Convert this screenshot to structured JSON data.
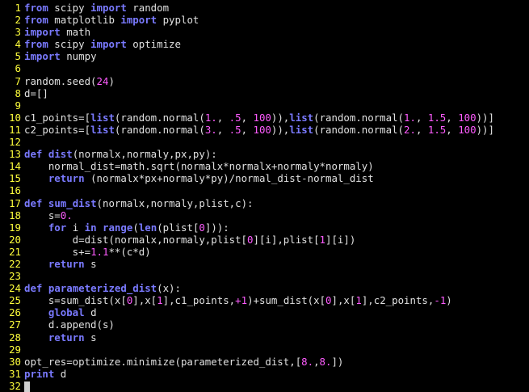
{
  "editor": {
    "colors": {
      "background": "#000000",
      "line_number": "#ffff3c",
      "text": "#e0e0e0",
      "keyword": "#7a7aff",
      "number": "#ff5cff",
      "builtin": "#3fe0ff"
    },
    "lines": [
      {
        "n": "1",
        "tokens": [
          {
            "t": "from",
            "c": "kw"
          },
          {
            "t": " scipy "
          },
          {
            "t": "import",
            "c": "kw"
          },
          {
            "t": " random"
          }
        ]
      },
      {
        "n": "2",
        "tokens": [
          {
            "t": "from",
            "c": "kw"
          },
          {
            "t": " matplotlib "
          },
          {
            "t": "import",
            "c": "kw"
          },
          {
            "t": " pyplot"
          }
        ]
      },
      {
        "n": "3",
        "tokens": [
          {
            "t": "import",
            "c": "kw"
          },
          {
            "t": " math"
          }
        ]
      },
      {
        "n": "4",
        "tokens": [
          {
            "t": "from",
            "c": "kw"
          },
          {
            "t": " scipy "
          },
          {
            "t": "import",
            "c": "kw"
          },
          {
            "t": " optimize"
          }
        ]
      },
      {
        "n": "5",
        "tokens": [
          {
            "t": "import",
            "c": "kw"
          },
          {
            "t": " numpy"
          }
        ]
      },
      {
        "n": "6",
        "tokens": []
      },
      {
        "n": "7",
        "tokens": [
          {
            "t": "random.seed("
          },
          {
            "t": "24",
            "c": "num"
          },
          {
            "t": ")"
          }
        ]
      },
      {
        "n": "8",
        "tokens": [
          {
            "t": "d=[]"
          }
        ]
      },
      {
        "n": "9",
        "tokens": []
      },
      {
        "n": "10",
        "tokens": [
          {
            "t": "c1_points=["
          },
          {
            "t": "list",
            "c": "kw"
          },
          {
            "t": "(random.normal("
          },
          {
            "t": "1.",
            "c": "num"
          },
          {
            "t": ", "
          },
          {
            "t": ".5",
            "c": "num"
          },
          {
            "t": ", "
          },
          {
            "t": "100",
            "c": "num"
          },
          {
            "t": ")),"
          },
          {
            "t": "list",
            "c": "kw"
          },
          {
            "t": "(random.normal("
          },
          {
            "t": "1.",
            "c": "num"
          },
          {
            "t": ", "
          },
          {
            "t": "1.5",
            "c": "num"
          },
          {
            "t": ", "
          },
          {
            "t": "100",
            "c": "num"
          },
          {
            "t": "))]"
          }
        ]
      },
      {
        "n": "11",
        "tokens": [
          {
            "t": "c2_points=["
          },
          {
            "t": "list",
            "c": "kw"
          },
          {
            "t": "(random.normal("
          },
          {
            "t": "3.",
            "c": "num"
          },
          {
            "t": ", "
          },
          {
            "t": ".5",
            "c": "num"
          },
          {
            "t": ", "
          },
          {
            "t": "100",
            "c": "num"
          },
          {
            "t": ")),"
          },
          {
            "t": "list",
            "c": "kw"
          },
          {
            "t": "(random.normal("
          },
          {
            "t": "2.",
            "c": "num"
          },
          {
            "t": ", "
          },
          {
            "t": "1.5",
            "c": "num"
          },
          {
            "t": ", "
          },
          {
            "t": "100",
            "c": "num"
          },
          {
            "t": "))]"
          }
        ]
      },
      {
        "n": "12",
        "tokens": []
      },
      {
        "n": "13",
        "tokens": [
          {
            "t": "def",
            "c": "kw"
          },
          {
            "t": " "
          },
          {
            "t": "dist",
            "c": "kw"
          },
          {
            "t": "(normalx,normaly,px,py):"
          }
        ]
      },
      {
        "n": "14",
        "tokens": [
          {
            "t": "    normal_dist=math.sqrt(normalx*normalx+normaly*normaly)"
          }
        ]
      },
      {
        "n": "15",
        "tokens": [
          {
            "t": "    "
          },
          {
            "t": "return",
            "c": "kw"
          },
          {
            "t": " (normalx*px+normaly*py)/normal_dist-normal_dist"
          }
        ]
      },
      {
        "n": "16",
        "tokens": []
      },
      {
        "n": "17",
        "tokens": [
          {
            "t": "def",
            "c": "kw"
          },
          {
            "t": " "
          },
          {
            "t": "sum_dist",
            "c": "kw"
          },
          {
            "t": "(normalx,normaly,plist,c):"
          }
        ]
      },
      {
        "n": "18",
        "tokens": [
          {
            "t": "    s="
          },
          {
            "t": "0.",
            "c": "num"
          }
        ]
      },
      {
        "n": "19",
        "tokens": [
          {
            "t": "    "
          },
          {
            "t": "for",
            "c": "kw"
          },
          {
            "t": " i "
          },
          {
            "t": "in",
            "c": "kw"
          },
          {
            "t": " "
          },
          {
            "t": "range",
            "c": "kw"
          },
          {
            "t": "("
          },
          {
            "t": "len",
            "c": "kw"
          },
          {
            "t": "(plist["
          },
          {
            "t": "0",
            "c": "num"
          },
          {
            "t": "])):"
          }
        ]
      },
      {
        "n": "20",
        "tokens": [
          {
            "t": "        d=dist(normalx,normaly,plist["
          },
          {
            "t": "0",
            "c": "num"
          },
          {
            "t": "][i],plist["
          },
          {
            "t": "1",
            "c": "num"
          },
          {
            "t": "][i])"
          }
        ]
      },
      {
        "n": "21",
        "tokens": [
          {
            "t": "        s+="
          },
          {
            "t": "1.1",
            "c": "num"
          },
          {
            "t": "**(c*d)"
          }
        ]
      },
      {
        "n": "22",
        "tokens": [
          {
            "t": "    "
          },
          {
            "t": "return",
            "c": "kw"
          },
          {
            "t": " s"
          }
        ]
      },
      {
        "n": "23",
        "tokens": []
      },
      {
        "n": "24",
        "tokens": [
          {
            "t": "def",
            "c": "kw"
          },
          {
            "t": " "
          },
          {
            "t": "parameterized_dist",
            "c": "kw"
          },
          {
            "t": "(x):"
          }
        ]
      },
      {
        "n": "25",
        "tokens": [
          {
            "t": "    s=sum_dist(x["
          },
          {
            "t": "0",
            "c": "num"
          },
          {
            "t": "],x["
          },
          {
            "t": "1",
            "c": "num"
          },
          {
            "t": "],c1_points,"
          },
          {
            "t": "+1",
            "c": "num"
          },
          {
            "t": ")+sum_dist(x["
          },
          {
            "t": "0",
            "c": "num"
          },
          {
            "t": "],x["
          },
          {
            "t": "1",
            "c": "num"
          },
          {
            "t": "],c2_points,"
          },
          {
            "t": "-1",
            "c": "num"
          },
          {
            "t": ")"
          }
        ]
      },
      {
        "n": "26",
        "tokens": [
          {
            "t": "    "
          },
          {
            "t": "global",
            "c": "kw"
          },
          {
            "t": " d"
          }
        ]
      },
      {
        "n": "27",
        "tokens": [
          {
            "t": "    d.append(s)"
          }
        ]
      },
      {
        "n": "28",
        "tokens": [
          {
            "t": "    "
          },
          {
            "t": "return",
            "c": "kw"
          },
          {
            "t": " s"
          }
        ]
      },
      {
        "n": "29",
        "tokens": []
      },
      {
        "n": "30",
        "tokens": [
          {
            "t": "opt_res=optimize.minimize(parameterized_dist,["
          },
          {
            "t": "8.",
            "c": "num"
          },
          {
            "t": ","
          },
          {
            "t": "8.",
            "c": "num"
          },
          {
            "t": "])"
          }
        ]
      },
      {
        "n": "31",
        "tokens": [
          {
            "t": "print",
            "c": "kw"
          },
          {
            "t": " d"
          }
        ]
      },
      {
        "n": "32",
        "tokens": [],
        "cursor": true
      }
    ]
  }
}
